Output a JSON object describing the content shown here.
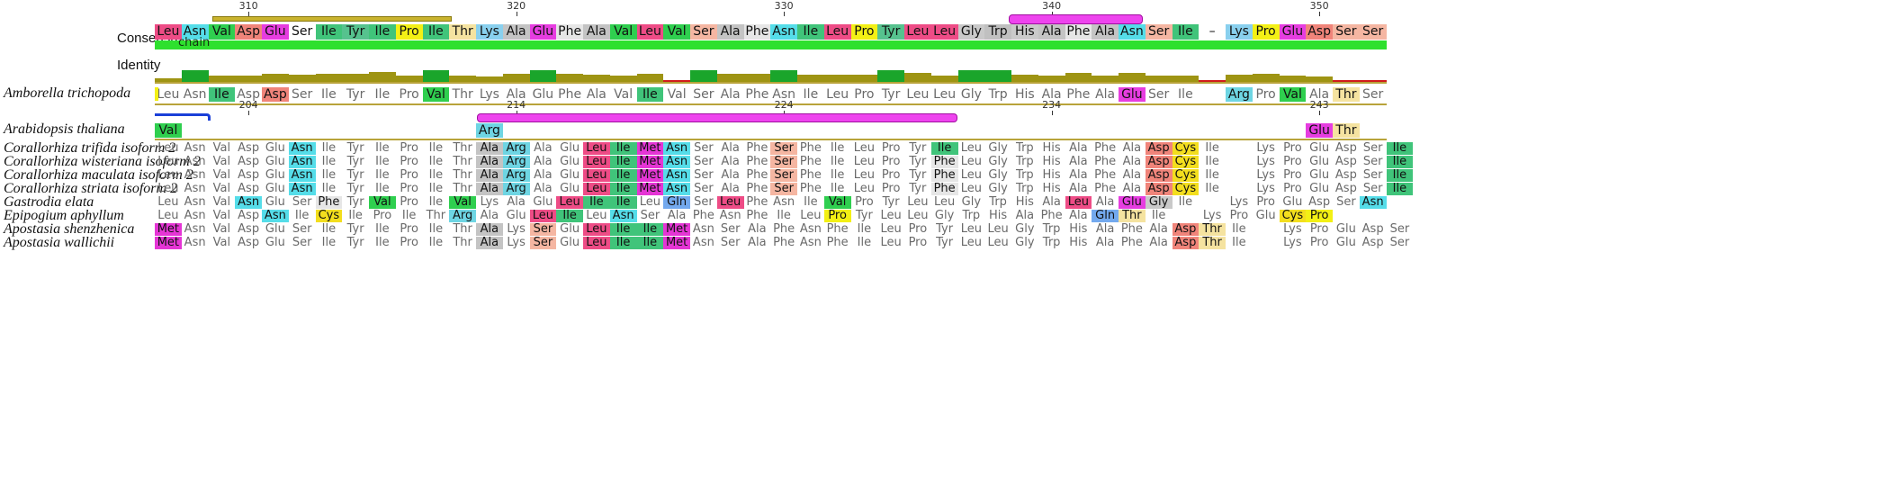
{
  "labels": {
    "consensus": "Consensus",
    "identity": "Identity",
    "chain": "chain",
    "gap_char": "–"
  },
  "residue_colors": {
    "Leu": "#ee4c86",
    "Asn": "#55dde9",
    "Val": "#2fcf4f",
    "Asp": "#f0847a",
    "Glu": "#e63de0",
    "Ser": "#f5b6a2",
    "Ile": "#40c47a",
    "Tyr": "#56c28e",
    "Pro": "#f3f015",
    "Thr": "#f5e3a0",
    "Lys": "#89d0ee",
    "Ala": "#c4c4c4",
    "Phe": "#e6e6e6",
    "Gly": "#c9c9c9",
    "Trp": "#c0c0c0",
    "His": "#cacaca",
    "Arg": "#6ed5e3",
    "Met": "#e535d5",
    "Gln": "#73a9ee",
    "Cys": "#f3de1e"
  },
  "ruler_top": {
    "labels": [
      "310",
      "320",
      "330",
      "340",
      "350"
    ],
    "label_cols": [
      3,
      13,
      23,
      33,
      43
    ]
  },
  "ruler_mid": {
    "labels": [
      "204",
      "214",
      "224",
      "234",
      "243"
    ],
    "label_cols": [
      3,
      13,
      23,
      33,
      43
    ]
  },
  "consensus": [
    "Leu",
    "Asn",
    "Val",
    "Asp",
    "Glu",
    "Ser",
    "Ile",
    "Tyr",
    "Ile",
    "Pro",
    "Ile",
    "Thr",
    "Lys",
    "Ala",
    "Glu",
    "Phe",
    "Ala",
    "Val",
    "Leu",
    "Val",
    "Ser",
    "Ala",
    "Phe",
    "Asn",
    "Ile",
    "Leu",
    "Pro",
    "Tyr",
    "Leu",
    "Leu",
    "Gly",
    "Trp",
    "His",
    "Ala",
    "Phe",
    "Ala",
    "Asn",
    "Ser",
    "Ile",
    "–",
    "Lys",
    "Pro",
    "Glu",
    "Asp",
    "Ser",
    "Ser"
  ],
  "consensus_hl": [
    1,
    1,
    1,
    1,
    1,
    0,
    1,
    1,
    1,
    1,
    1,
    1,
    1,
    1,
    1,
    1,
    1,
    1,
    1,
    1,
    1,
    1,
    1,
    1,
    1,
    1,
    1,
    1,
    1,
    1,
    1,
    1,
    1,
    1,
    1,
    1,
    1,
    1,
    1,
    0,
    1,
    1,
    1,
    1,
    1,
    1
  ],
  "identity": [
    0.25,
    0.8,
    0.45,
    0.45,
    0.55,
    0.5,
    0.55,
    0.55,
    0.7,
    0.45,
    0.8,
    0.45,
    0.4,
    0.55,
    0.8,
    0.55,
    0.5,
    0.45,
    0.55,
    0.1,
    0.8,
    0.55,
    0.55,
    0.8,
    0.5,
    0.5,
    0.5,
    0.8,
    0.6,
    0.45,
    0.8,
    0.8,
    0.5,
    0.45,
    0.6,
    0.45,
    0.65,
    0.45,
    0.45,
    0.05,
    0.5,
    0.55,
    0.45,
    0.4,
    0.15,
    0.15
  ],
  "reference": {
    "name": "Amborella trichopoda",
    "residues": [
      "Leu",
      "Asn",
      "Ile",
      "Asp",
      "Asp",
      "Ser",
      "Ile",
      "Tyr",
      "Ile",
      "Pro",
      "Val",
      "Thr",
      "Lys",
      "Ala",
      "Glu",
      "Phe",
      "Ala",
      "Val",
      "Ile",
      "Val",
      "Ser",
      "Ala",
      "Phe",
      "Asn",
      "Ile",
      "Leu",
      "Pro",
      "Tyr",
      "Leu",
      "Leu",
      "Gly",
      "Trp",
      "His",
      "Ala",
      "Phe",
      "Ala",
      "Glu",
      "Ser",
      "Ile",
      "",
      "Arg",
      "Pro",
      "Val",
      "Ala",
      "Thr",
      "Ser"
    ],
    "hl": [
      2,
      4,
      10,
      18,
      36,
      40,
      42,
      44
    ]
  },
  "second": {
    "name": "Arabidopsis thaliana",
    "residues": [
      "Val",
      "",
      "",
      "",
      "",
      "",
      "",
      "",
      "",
      "",
      "",
      "",
      "Arg",
      "",
      "",
      "",
      "",
      "",
      "",
      "",
      "",
      "",
      "",
      "",
      "",
      "",
      "",
      "",
      "",
      "",
      "",
      "",
      "",
      "",
      "",
      "",
      "",
      "",
      "",
      "",
      "",
      "",
      "",
      "Glu",
      "Thr",
      ""
    ],
    "hl": [
      0,
      12,
      43,
      44
    ]
  },
  "rows": [
    {
      "name": "Corallorhiza trifida isoform 2",
      "r": [
        "Leu",
        "Asn",
        "Val",
        "Asp",
        "Glu",
        "Asn",
        "Ile",
        "Tyr",
        "Ile",
        "Pro",
        "Ile",
        "Thr",
        "Ala",
        "Arg",
        "Ala",
        "Glu",
        "Leu",
        "Ile",
        "Ile",
        "Met",
        "Asn",
        "Ser",
        "Ala",
        "Phe",
        "Ser",
        "Phe",
        "Ile",
        "Leu",
        "Pro",
        "Tyr",
        "Ile",
        "Leu",
        "Gly",
        "Trp",
        "His",
        "Ala",
        "Phe",
        "Ala",
        "Asp",
        "Cys",
        "Ile",
        "Lys",
        "Pro",
        "Glu",
        "Asp",
        "Ser",
        "Ile"
      ],
      "hl": [
        5,
        12,
        13,
        16,
        17,
        18,
        19,
        20,
        24,
        30,
        38,
        39,
        46
      ]
    }
  ],
  "species": [
    {
      "name": "Corallorhiza trifida isoform 2",
      "r": [
        "Leu",
        "Asn",
        "Val",
        "Asp",
        "Glu",
        "Asn",
        "Ile",
        "Tyr",
        "Ile",
        "Pro",
        "Ile",
        "Thr",
        "Ala",
        "Arg",
        "Ala",
        "Glu",
        "Leu",
        "Ile",
        "Met",
        "Asn",
        "Ser",
        "Ala",
        "Phe",
        "Ser",
        "Phe",
        "Ile",
        "Leu",
        "Pro",
        "Tyr",
        "Ile",
        "Leu",
        "Gly",
        "Trp",
        "His",
        "Ala",
        "Phe",
        "Ala",
        "Asp",
        "Cys",
        "Ile",
        "",
        "Lys",
        "Pro",
        "Glu",
        "Asp",
        "Ser",
        "Ile"
      ],
      "hl": [
        5,
        12,
        13,
        16,
        17,
        18,
        19,
        23,
        29,
        37,
        38,
        46
      ]
    },
    {
      "name": "Corallorhiza wisteriana isoform 2",
      "r": [
        "Leu",
        "Asn",
        "Val",
        "Asp",
        "Glu",
        "Asn",
        "Ile",
        "Tyr",
        "Ile",
        "Pro",
        "Ile",
        "Thr",
        "Ala",
        "Arg",
        "Ala",
        "Glu",
        "Leu",
        "Ile",
        "Met",
        "Asn",
        "Ser",
        "Ala",
        "Phe",
        "Ser",
        "Phe",
        "Ile",
        "Leu",
        "Pro",
        "Tyr",
        "Phe",
        "Leu",
        "Gly",
        "Trp",
        "His",
        "Ala",
        "Phe",
        "Ala",
        "Asp",
        "Cys",
        "Ile",
        "",
        "Lys",
        "Pro",
        "Glu",
        "Asp",
        "Ser",
        "Ile"
      ],
      "hl": [
        5,
        12,
        13,
        16,
        17,
        18,
        19,
        23,
        29,
        37,
        38,
        46
      ]
    },
    {
      "name": "Corallorhiza maculata isoform 2",
      "r": [
        "Leu",
        "Asn",
        "Val",
        "Asp",
        "Glu",
        "Asn",
        "Ile",
        "Tyr",
        "Ile",
        "Pro",
        "Ile",
        "Thr",
        "Ala",
        "Arg",
        "Ala",
        "Glu",
        "Leu",
        "Ile",
        "Met",
        "Asn",
        "Ser",
        "Ala",
        "Phe",
        "Ser",
        "Phe",
        "Ile",
        "Leu",
        "Pro",
        "Tyr",
        "Phe",
        "Leu",
        "Gly",
        "Trp",
        "His",
        "Ala",
        "Phe",
        "Ala",
        "Asp",
        "Cys",
        "Ile",
        "",
        "Lys",
        "Pro",
        "Glu",
        "Asp",
        "Ser",
        "Ile"
      ],
      "hl": [
        5,
        12,
        13,
        16,
        17,
        18,
        19,
        23,
        29,
        37,
        38,
        46
      ]
    },
    {
      "name": "Corallorhiza striata isoform 2",
      "r": [
        "Leu",
        "Asn",
        "Val",
        "Asp",
        "Glu",
        "Asn",
        "Ile",
        "Tyr",
        "Ile",
        "Pro",
        "Ile",
        "Thr",
        "Ala",
        "Arg",
        "Ala",
        "Glu",
        "Leu",
        "Ile",
        "Met",
        "Asn",
        "Ser",
        "Ala",
        "Phe",
        "Ser",
        "Phe",
        "Ile",
        "Leu",
        "Pro",
        "Tyr",
        "Phe",
        "Leu",
        "Gly",
        "Trp",
        "His",
        "Ala",
        "Phe",
        "Ala",
        "Asp",
        "Cys",
        "Ile",
        "",
        "Lys",
        "Pro",
        "Glu",
        "Asp",
        "Ser",
        "Ile"
      ],
      "hl": [
        5,
        12,
        13,
        16,
        17,
        18,
        19,
        23,
        29,
        37,
        38,
        46
      ]
    },
    {
      "name": "Gastrodia elata",
      "r": [
        "Leu",
        "Asn",
        "Val",
        "Asn",
        "Glu",
        "Ser",
        "Phe",
        "Tyr",
        "Val",
        "Pro",
        "Ile",
        "Val",
        "Lys",
        "Ala",
        "Glu",
        "Leu",
        "Ile",
        "Ile",
        "Leu",
        "Gln",
        "Ser",
        "Leu",
        "Phe",
        "Asn",
        "Ile",
        "Val",
        "Pro",
        "Tyr",
        "Leu",
        "Leu",
        "Gly",
        "Trp",
        "His",
        "Ala",
        "Leu",
        "Ala",
        "Glu",
        "Gly",
        "Ile",
        "",
        "Lys",
        "Pro",
        "Glu",
        "Asp",
        "Ser",
        "Asn"
      ],
      "hl": [
        3,
        6,
        8,
        11,
        15,
        16,
        17,
        19,
        21,
        25,
        34,
        36,
        37,
        45
      ]
    },
    {
      "name": "Epipogium aphyllum",
      "r": [
        "Leu",
        "Asn",
        "Val",
        "Asp",
        "Asn",
        "Ile",
        "Cys",
        "Ile",
        "Pro",
        "Ile",
        "Thr",
        "Arg",
        "Ala",
        "Glu",
        "Leu",
        "Ile",
        "Leu",
        "Asn",
        "Ser",
        "Ala",
        "Phe",
        "Asn",
        "Phe",
        "Ile",
        "Leu",
        "Pro",
        "Tyr",
        "Leu",
        "Leu",
        "Gly",
        "Trp",
        "His",
        "Ala",
        "Phe",
        "Ala",
        "Gln",
        "Thr",
        "Ile",
        "",
        "Lys",
        "Pro",
        "Glu",
        "Cys",
        "Pro",
        "",
        ""
      ],
      "hl": [
        4,
        6,
        11,
        14,
        15,
        17,
        25,
        35,
        36,
        42,
        43
      ]
    },
    {
      "name": "Apostasia shenzhenica",
      "r": [
        "Met",
        "Asn",
        "Val",
        "Asp",
        "Glu",
        "Ser",
        "Ile",
        "Tyr",
        "Ile",
        "Pro",
        "Ile",
        "Thr",
        "Ala",
        "Lys",
        "Ser",
        "Glu",
        "Leu",
        "Ile",
        "Ile",
        "Met",
        "Asn",
        "Ser",
        "Ala",
        "Phe",
        "Asn",
        "Phe",
        "Ile",
        "Leu",
        "Pro",
        "Tyr",
        "Leu",
        "Leu",
        "Gly",
        "Trp",
        "His",
        "Ala",
        "Phe",
        "Ala",
        "Asp",
        "Thr",
        "Ile",
        "",
        "Lys",
        "Pro",
        "Glu",
        "Asp",
        "Ser"
      ],
      "hl": [
        0,
        12,
        14,
        16,
        17,
        18,
        19,
        38,
        39
      ]
    },
    {
      "name": "Apostasia wallichii",
      "r": [
        "Met",
        "Asn",
        "Val",
        "Asp",
        "Glu",
        "Ser",
        "Ile",
        "Tyr",
        "Ile",
        "Pro",
        "Ile",
        "Thr",
        "Ala",
        "Lys",
        "Ser",
        "Glu",
        "Leu",
        "Ile",
        "Ile",
        "Met",
        "Asn",
        "Ser",
        "Ala",
        "Phe",
        "Asn",
        "Phe",
        "Ile",
        "Leu",
        "Pro",
        "Tyr",
        "Leu",
        "Leu",
        "Gly",
        "Trp",
        "His",
        "Ala",
        "Phe",
        "Ala",
        "Asp",
        "Thr",
        "Ile",
        "",
        "Lys",
        "Pro",
        "Glu",
        "Asp",
        "Ser"
      ],
      "hl": [
        0,
        12,
        14,
        16,
        17,
        18,
        19,
        38,
        39
      ]
    }
  ]
}
